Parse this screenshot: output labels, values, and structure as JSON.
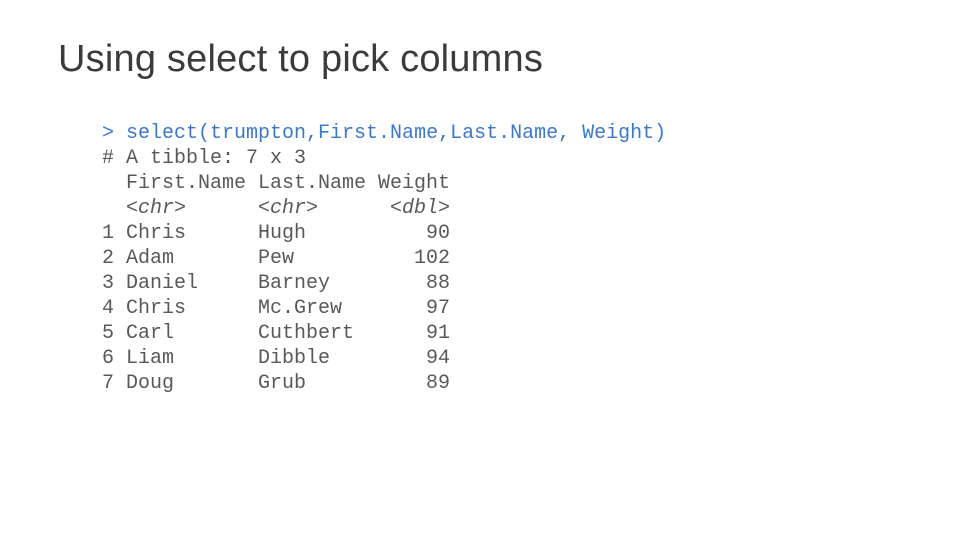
{
  "title": "Using select to pick columns",
  "code": {
    "prompt": "> ",
    "command": "select(trumpton,First.Name,Last.Name, Weight)",
    "rows": {
      "tibble": "# A tibble: 7 x 3",
      "header": "  First.Name Last.Name Weight",
      "types": "  <chr>      <chr>      <dbl>",
      "r1": "1 Chris      Hugh          90",
      "r2": "2 Adam       Pew          102",
      "r3": "3 Daniel     Barney        88",
      "r4": "4 Chris      Mc.Grew       97",
      "r5": "5 Carl       Cuthbert      91",
      "r6": "6 Liam       Dibble        94",
      "r7": "7 Doug       Grub          89"
    }
  },
  "chart_data": {
    "type": "table",
    "title": "A tibble: 7 x 3",
    "columns": [
      "First.Name",
      "Last.Name",
      "Weight"
    ],
    "col_types": [
      "<chr>",
      "<chr>",
      "<dbl>"
    ],
    "rows": [
      {
        "First.Name": "Chris",
        "Last.Name": "Hugh",
        "Weight": 90
      },
      {
        "First.Name": "Adam",
        "Last.Name": "Pew",
        "Weight": 102
      },
      {
        "First.Name": "Daniel",
        "Last.Name": "Barney",
        "Weight": 88
      },
      {
        "First.Name": "Chris",
        "Last.Name": "Mc.Grew",
        "Weight": 97
      },
      {
        "First.Name": "Carl",
        "Last.Name": "Cuthbert",
        "Weight": 91
      },
      {
        "First.Name": "Liam",
        "Last.Name": "Dibble",
        "Weight": 94
      },
      {
        "First.Name": "Doug",
        "Last.Name": "Grub",
        "Weight": 89
      }
    ]
  }
}
